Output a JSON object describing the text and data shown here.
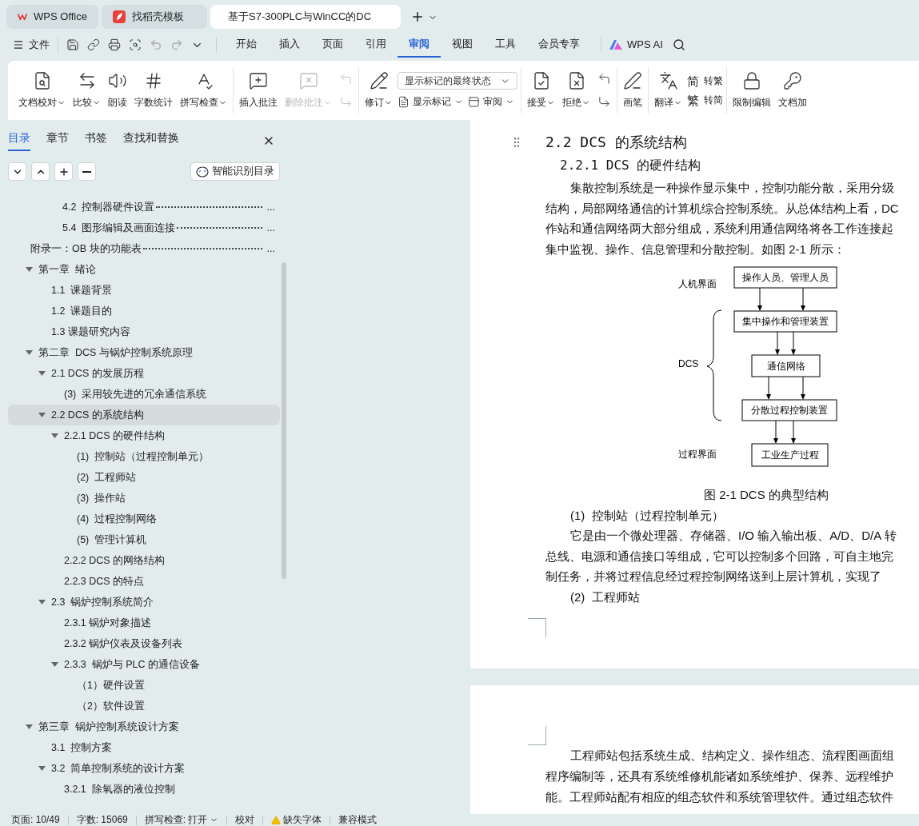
{
  "title_bar": {
    "tabs": [
      {
        "label": "WPS Office",
        "kind": "home",
        "selected": false
      },
      {
        "label": "找稻壳模板",
        "kind": "template",
        "selected": false
      },
      {
        "label": "基于S7-300PLC与WinCC的DC",
        "kind": "document",
        "selected": true
      }
    ]
  },
  "menu_bar": {
    "file_label": "文件",
    "tabs": [
      {
        "label": "开始",
        "selected": false
      },
      {
        "label": "插入",
        "selected": false
      },
      {
        "label": "页面",
        "selected": false
      },
      {
        "label": "引用",
        "selected": false
      },
      {
        "label": "审阅",
        "selected": true
      },
      {
        "label": "视图",
        "selected": false
      },
      {
        "label": "工具",
        "selected": false
      },
      {
        "label": "会员专享",
        "selected": false
      }
    ],
    "ai_label": "WPS AI"
  },
  "ribbon": {
    "groups": [
      {
        "columns": [
          [
            [
              {
                "kind": "large",
                "label": "文档校对",
                "dropdown": true,
                "disabled": false
              }
            ]
          ],
          [
            [
              {
                "kind": "large",
                "label": "比较",
                "dropdown": true,
                "disabled": false
              }
            ]
          ],
          [
            [
              {
                "kind": "large",
                "label": "朗读",
                "dropdown": false,
                "disabled": false
              }
            ]
          ],
          [
            [
              {
                "kind": "large",
                "label": "字数统计",
                "dropdown": false,
                "disabled": false
              }
            ]
          ],
          [
            [
              {
                "kind": "large",
                "label": "拼写检查",
                "dropdown": true,
                "disabled": false
              }
            ]
          ]
        ]
      },
      {
        "columns": [
          [
            [
              {
                "kind": "large",
                "label": "插入批注",
                "dropdown": false,
                "disabled": false
              }
            ]
          ],
          [
            [
              {
                "kind": "large",
                "label": "删除批注",
                "dropdown": true,
                "disabled": true
              }
            ]
          ],
          [
            [
              {
                "kind": "icon",
                "disabled": true
              }
            ],
            [
              {
                "kind": "icon",
                "disabled": true
              }
            ]
          ]
        ]
      },
      {
        "columns": [
          [
            [
              {
                "kind": "large",
                "label": "修订",
                "dropdown": true,
                "disabled": false
              }
            ]
          ],
          [
            [
              {
                "kind": "select",
                "value": "显示标记的最终状态"
              }
            ],
            [
              {
                "kind": "small",
                "label": "显示标记",
                "dropdown": true,
                "disabled": false
              },
              {
                "kind": "small",
                "label": "审阅",
                "dropdown": true,
                "disabled": false
              }
            ]
          ]
        ]
      },
      {
        "columns": [
          [
            [
              {
                "kind": "large",
                "label": "接受",
                "dropdown": true,
                "disabled": false
              }
            ]
          ],
          [
            [
              {
                "kind": "large",
                "label": "拒绝",
                "dropdown": true,
                "disabled": false
              }
            ]
          ],
          [
            [
              {
                "kind": "icon",
                "disabled": false
              }
            ],
            [
              {
                "kind": "icon",
                "disabled": false
              }
            ]
          ]
        ]
      },
      {
        "columns": [
          [
            [
              {
                "kind": "large",
                "label": "画笔",
                "dropdown": false,
                "disabled": false
              }
            ]
          ]
        ]
      },
      {
        "columns": [
          [
            [
              {
                "kind": "large",
                "label": "翻译",
                "dropdown": true,
                "disabled": false
              }
            ]
          ],
          [
            [
              {
                "kind": "glyph",
                "glyph": "简",
                "label": "转繁",
                "disabled": false
              }
            ],
            [
              {
                "kind": "glyph",
                "glyph": "繁",
                "label": "转简",
                "disabled": false
              }
            ]
          ]
        ]
      },
      {
        "columns": [
          [
            [
              {
                "kind": "large",
                "label": "限制编辑",
                "dropdown": false,
                "disabled": false
              }
            ]
          ],
          [
            [
              {
                "kind": "large",
                "label": "文档加",
                "dropdown": false,
                "disabled": false
              }
            ]
          ]
        ]
      }
    ]
  },
  "nav_panel": {
    "tabs": [
      {
        "label": "目录",
        "selected": true
      },
      {
        "label": "章节",
        "selected": false
      },
      {
        "label": "书签",
        "selected": false
      },
      {
        "label": "查找和替换",
        "selected": false
      }
    ],
    "smart_button": "智能识别目录",
    "leader_entries": [
      {
        "kind": "section",
        "label": "4.2  控制器硬件设置",
        "page": "..."
      },
      {
        "kind": "section",
        "label": "5.4  图形编辑及画面连接",
        "page": "..."
      },
      {
        "kind": "appendix",
        "label": "附录一：OB 块的功能表",
        "page": "..."
      }
    ],
    "toc": [
      {
        "label": "第一章  绪论",
        "expanded": true,
        "selected": false,
        "children": [
          {
            "label": "1.1  课题背景",
            "selected": false
          },
          {
            "label": "1.2  课题目的",
            "selected": false
          },
          {
            "label": "1.3 课题研究内容",
            "selected": false
          }
        ]
      },
      {
        "label": "第二章  DCS 与锅炉控制系统原理",
        "expanded": true,
        "selected": false,
        "children": [
          {
            "label": "2.1 DCS 的发展历程",
            "expanded": true,
            "selected": false,
            "children": [
              {
                "label": "(3)  采用较先进的冗余通信系统",
                "selected": false
              }
            ]
          },
          {
            "label": "2.2 DCS 的系统结构",
            "expanded": true,
            "selected": true,
            "children": [
              {
                "label": "2.2.1 DCS 的硬件结构",
                "expanded": true,
                "selected": false,
                "children": [
                  {
                    "label": "(1)  控制站（过程控制单元）",
                    "selected": false
                  },
                  {
                    "label": "(2)  工程师站",
                    "selected": false
                  },
                  {
                    "label": "(3)  操作站",
                    "selected": false
                  },
                  {
                    "label": "(4)  过程控制网络",
                    "selected": false
                  },
                  {
                    "label": "(5)  管理计算机",
                    "selected": false
                  }
                ]
              },
              {
                "label": "2.2.2 DCS 的网络结构",
                "selected": false
              },
              {
                "label": "2.2.3 DCS 的特点",
                "selected": false
              }
            ]
          },
          {
            "label": "2.3  锅炉控制系统简介",
            "expanded": true,
            "selected": false,
            "children": [
              {
                "label": "2.3.1 锅炉对象描述",
                "selected": false
              },
              {
                "label": "2.3.2 锅炉仪表及设备列表",
                "selected": false
              },
              {
                "label": "2.3.3  锅炉与 PLC 的通信设备",
                "expanded": true,
                "selected": false,
                "children": [
                  {
                    "label": "（1）硬件设置",
                    "selected": false
                  },
                  {
                    "label": "（2）软件设置",
                    "selected": false
                  }
                ]
              }
            ]
          }
        ]
      },
      {
        "label": "第三章  锅炉控制系统设计方案",
        "expanded": true,
        "selected": false,
        "children": [
          {
            "label": "3.1  控制方案",
            "selected": false
          },
          {
            "label": "3.2  简单控制系统的设计方案",
            "expanded": true,
            "selected": false,
            "children": [
              {
                "label": "3.2.1  除氧器的液位控制",
                "selected": false
              }
            ]
          }
        ]
      }
    ]
  },
  "document": {
    "heading": "2.2 DCS 的系统结构",
    "subheading": "2.2.1 DCS 的硬件结构",
    "paragraph_1": [
      "集散控制系统是一种操作显示集中，控制功能分散，采用分级",
      "结构，局部网络通信的计算机综合控制系统。从总体结构上看，DC",
      "作站和通信网络两大部分组成，系统利用通信网络将各工作连接起",
      "集中监视、操作、信息管理和分散控制。如图 2-1 所示："
    ],
    "diagram": {
      "layers": [
        "人机界面",
        "DCS",
        "过程界面"
      ],
      "boxes": [
        "操作人员、管理人员",
        "集中操作和管理装置",
        "通信网络",
        "分散过程控制装置",
        "工业生产过程"
      ]
    },
    "caption": "图 2-1 DCS 的典型结构",
    "item_1": "(1)  控制站（过程控制单元）",
    "paragraph_2": [
      "它是由一个微处理器、存储器、I/O 输入输出板、A/D、D/A 转",
      "总线、电源和通信接口等组成，它可以控制多个回路，可自主地完",
      "制任务，并将过程信息经过程控制网络送到上层计算机，实现了"
    ],
    "item_2": "(2)  工程师站",
    "page_2_paragraph": [
      "工程师站包括系统生成、结构定义、操作组态、流程图画面组",
      "程序编制等，还具有系统维修机能诸如系统维护、保养、远程维护",
      "能。工程师站配有相应的组态软件和系统管理软件。通过组态软件"
    ]
  },
  "status_bar": [
    {
      "kind": "text",
      "label": "页面: 10/49"
    },
    {
      "kind": "text",
      "label": "字数: 15069"
    },
    {
      "kind": "dropdown",
      "label": "拼写检查: 打开"
    },
    {
      "kind": "text",
      "label": "校对"
    },
    {
      "kind": "warning",
      "label": "缺失字体"
    },
    {
      "kind": "text",
      "label": "兼容模式"
    }
  ]
}
